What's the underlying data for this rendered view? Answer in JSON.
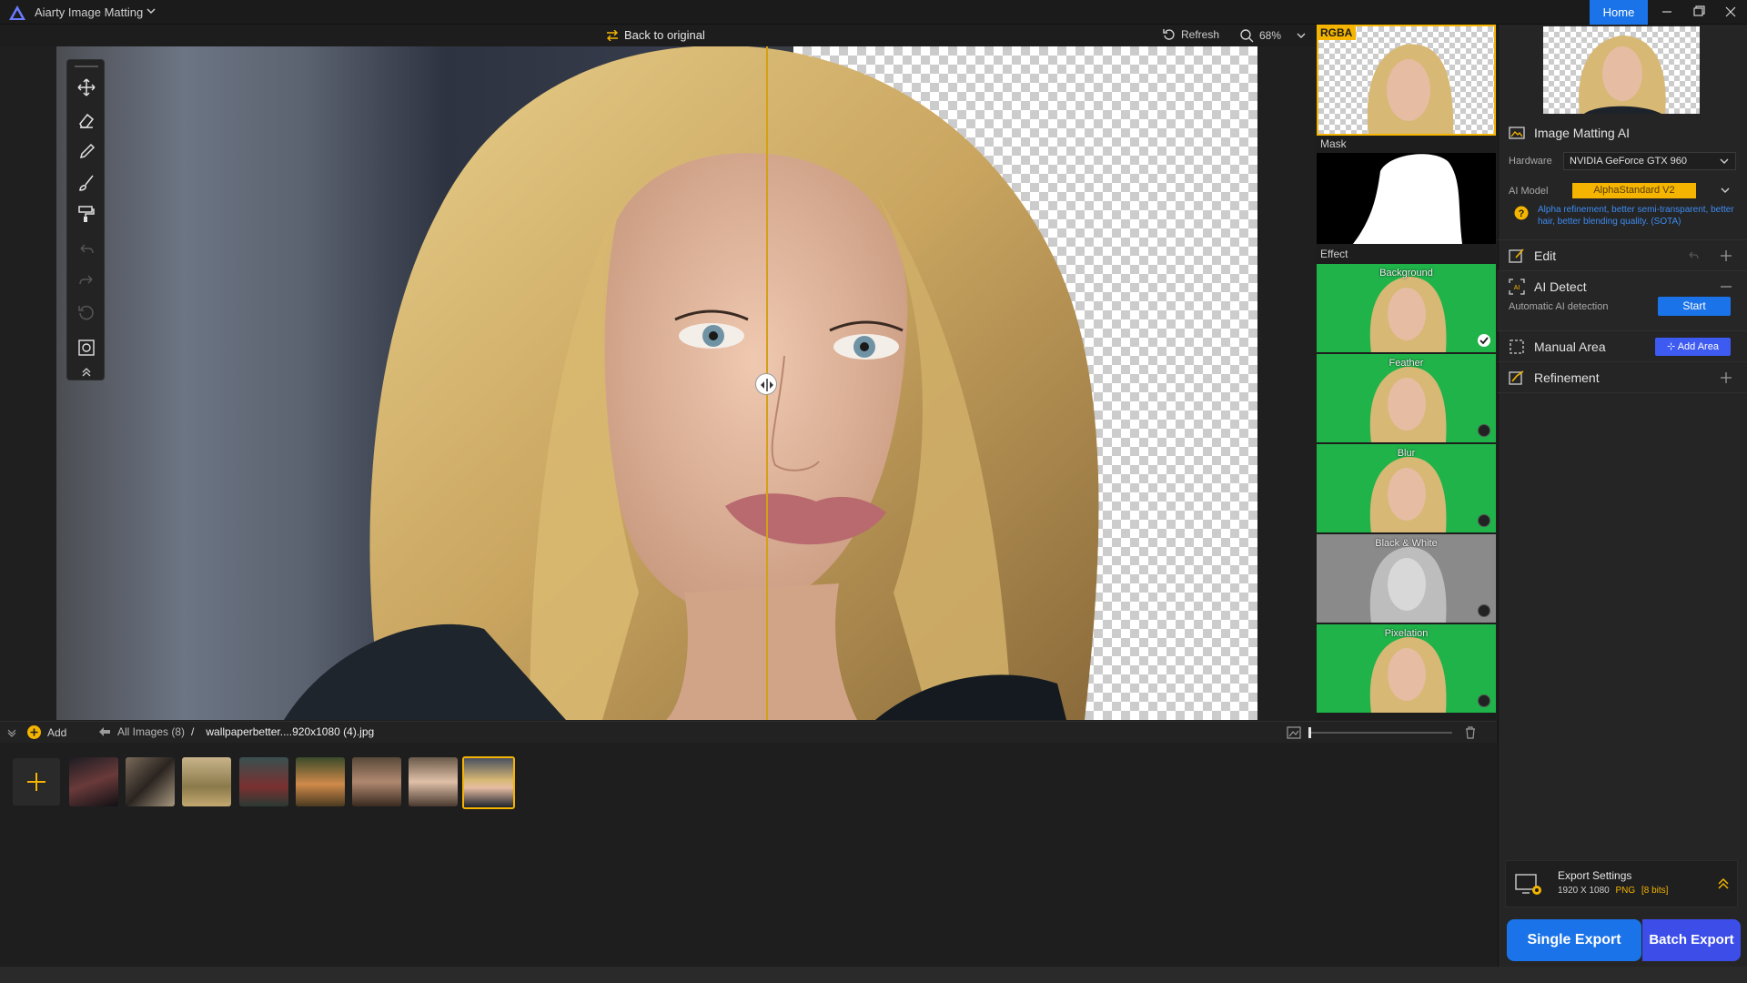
{
  "app": {
    "title": "Aiarty Image Matting",
    "home_label": "Home"
  },
  "canvas_bar": {
    "back_label": "Back to original",
    "refresh_label": "Refresh",
    "zoom_label": "68%"
  },
  "previews": {
    "rgba_label": "RGBA",
    "mask_label": "Mask",
    "effect_label": "Effect",
    "effects": [
      {
        "label": "Background",
        "color": "#1fb34a",
        "selected": true
      },
      {
        "label": "Feather",
        "color": "#1fb34a",
        "selected": false
      },
      {
        "label": "Blur",
        "color": "#1fb34a",
        "selected": false
      },
      {
        "label": "Black & White",
        "color": "#8a8a8a",
        "selected": false
      },
      {
        "label": "Pixelation",
        "color": "#1fb34a",
        "selected": false
      }
    ]
  },
  "panel": {
    "matting_title": "Image Matting AI",
    "hardware_label": "Hardware",
    "hardware_value": "NVIDIA GeForce GTX 960",
    "model_label": "AI Model",
    "model_value": "AlphaStandard  V2",
    "model_desc": "Alpha refinement, better semi-transparent, better hair, better blending quality. (SOTA)",
    "edit_title": "Edit",
    "detect_title": "AI Detect",
    "detect_desc": "Automatic AI detection",
    "start_label": "Start",
    "manual_title": "Manual Area",
    "add_area_label": "Add Area",
    "refinement_title": "Refinement"
  },
  "export": {
    "title": "Export Settings",
    "size": "1920 X 1080",
    "format": "PNG",
    "bits": "[8 bits]",
    "single_label": "Single Export",
    "batch_label": "Batch Export"
  },
  "filmstrip": {
    "add_label": "Add",
    "all_images_label": "All Images (8)",
    "separator": "/",
    "current_file": "wallpaperbetter....920x1080 (4).jpg"
  },
  "colors": {
    "accent": "#1a73e8",
    "rgba_tag": "#f4b400",
    "split_line": "#d4a017",
    "effect_green": "#1fb34a"
  }
}
